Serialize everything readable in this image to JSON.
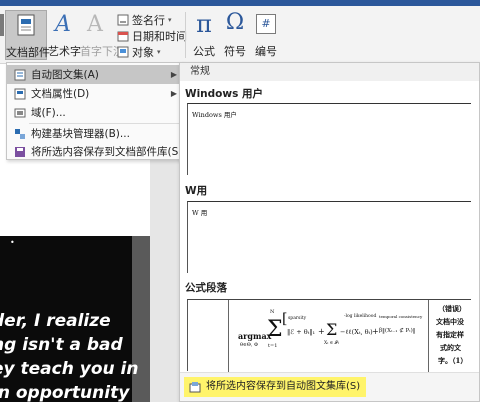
{
  "ribbon": {
    "doc_parts_label": "文档部件",
    "wordart_label": "艺术字",
    "dropcap_label": "首字下沉",
    "signature_line_label": "签名行",
    "datetime_label": "日期和时间",
    "object_label": "对象",
    "equation_label": "公式",
    "symbol_label": "符号",
    "number_label": "编号",
    "equation_glyph": "π",
    "symbol_glyph": "Ω",
    "number_glyph": "#",
    "wordart_glyph": "A",
    "dropcap_glyph": "A"
  },
  "menu": {
    "items": [
      {
        "label": "自动图文集(A)",
        "icon": "autotext-icon",
        "has_submenu": true,
        "highlighted": true
      },
      {
        "label": "文档属性(D)",
        "icon": "doc-properties-icon",
        "has_submenu": true,
        "highlighted": false
      },
      {
        "label": "域(F)...",
        "icon": "field-icon",
        "has_submenu": false,
        "highlighted": false
      },
      {
        "label": "构建基块管理器(B)...",
        "icon": "building-blocks-icon",
        "has_submenu": false,
        "highlighted": false
      },
      {
        "label": "将所选内容保存到文档部件库(S)...",
        "icon": "save-selection-icon",
        "has_submenu": false,
        "highlighted": false
      }
    ],
    "submenu_arrow": "▶"
  },
  "gallery": {
    "section_header": "常规",
    "entries": [
      {
        "category": "Windows 用户",
        "preview_text": "Windows  用户"
      },
      {
        "category": "W用",
        "preview_text": "W 用"
      },
      {
        "category": "公式段落",
        "preview_text": ""
      }
    ],
    "formula": {
      "argmax": "argmax",
      "argmax_sub": "θ∈Θ, Φ",
      "sum": "Σ",
      "sum_top": "N",
      "sum_bottom": "t=1",
      "sparsity_label": "sparsity",
      "sparsity_term": "‖ℰ + θₜ‖₁",
      "plus1": "+",
      "sum2": "Σ",
      "sum2_bottom": "Xₜ ∈ 𝒫ₜ",
      "loglik_label": "-log likelihood",
      "loglik_term": "−ℓℓ(Xₜ, θₜ)",
      "plus2": "+",
      "temporal_label": "temporal consistency",
      "temporal_term": "β‖(Xₜ₋₁ ⊄ Pₜ)‖",
      "side_lines": [
        "（错误）",
        "文档中没",
        "有指定样",
        "式的文",
        "字。（1）"
      ]
    },
    "footer_label": "将所选内容保存到自动图文集库(S)"
  },
  "document": {
    "image_lines": [
      "der, I realize",
      "ng isn't a bad",
      "ey teach you in",
      "in opportunity"
    ],
    "tiny_mark": "•"
  }
}
